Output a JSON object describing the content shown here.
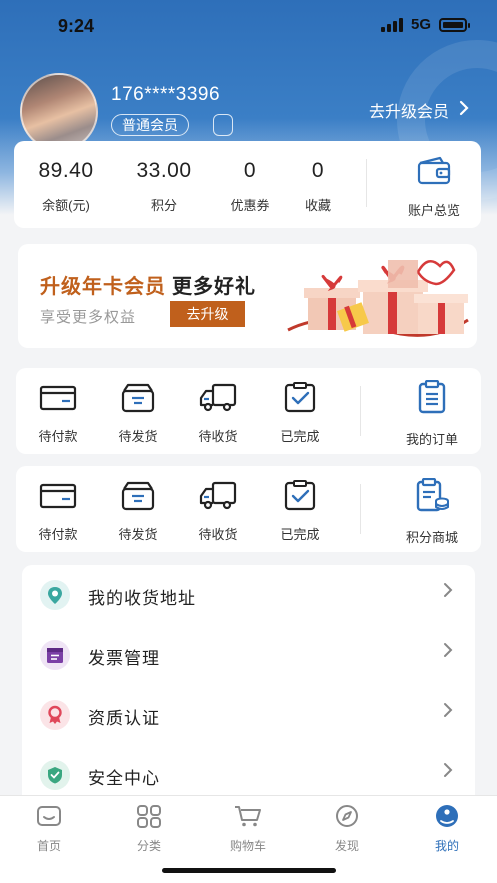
{
  "status_bar": {
    "time": "9:24",
    "network": "5G"
  },
  "profile": {
    "phone": "176****3396",
    "member_level": "普通会员",
    "upgrade_link": "去升级会员"
  },
  "stats": [
    {
      "value": "89.40",
      "label": "余额(元)"
    },
    {
      "value": "33.00",
      "label": "积分"
    },
    {
      "value": "0",
      "label": "优惠券"
    },
    {
      "value": "0",
      "label": "收藏"
    }
  ],
  "account_overview": {
    "label": "账户总览",
    "icon": "wallet-icon"
  },
  "banner": {
    "title_accent": "升级年卡会员",
    "title_rest": "更多好礼",
    "subtitle": "享受更多权益",
    "button": "去升级"
  },
  "orders": {
    "items": [
      {
        "label": "待付款",
        "icon": "card-icon"
      },
      {
        "label": "待发货",
        "icon": "box-icon"
      },
      {
        "label": "待收货",
        "icon": "truck-icon"
      },
      {
        "label": "已完成",
        "icon": "clipboard-check-icon"
      }
    ],
    "right": {
      "label": "我的订单",
      "icon": "order-list-icon"
    }
  },
  "points_orders": {
    "items": [
      {
        "label": "待付款",
        "icon": "card-icon"
      },
      {
        "label": "待发货",
        "icon": "box-icon"
      },
      {
        "label": "待收货",
        "icon": "truck-icon"
      },
      {
        "label": "已完成",
        "icon": "clipboard-check-icon"
      }
    ],
    "right": {
      "label": "积分商城",
      "icon": "points-mall-icon"
    }
  },
  "menu": [
    {
      "label": "我的收货地址",
      "icon": "location-icon",
      "color": "#3aa7a0"
    },
    {
      "label": "发票管理",
      "icon": "invoice-icon",
      "color": "#7b3fa6"
    },
    {
      "label": "资质认证",
      "icon": "certificate-icon",
      "color": "#e0475a"
    },
    {
      "label": "安全中心",
      "icon": "shield-icon",
      "color": "#3aa780"
    }
  ],
  "tabbar": [
    {
      "label": "首页",
      "icon": "home-icon",
      "active": false
    },
    {
      "label": "分类",
      "icon": "category-icon",
      "active": false
    },
    {
      "label": "购物车",
      "icon": "cart-icon",
      "active": false
    },
    {
      "label": "发现",
      "icon": "compass-icon",
      "active": false
    },
    {
      "label": "我的",
      "icon": "user-icon",
      "active": true
    }
  ],
  "colors": {
    "primary": "#2e6fb9",
    "accent": "#c0601c"
  }
}
